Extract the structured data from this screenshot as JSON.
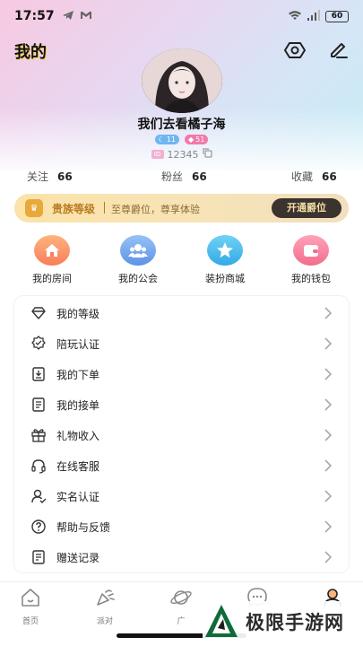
{
  "status_bar": {
    "time": "17:57",
    "battery": "60"
  },
  "header": {
    "title": "我的"
  },
  "profile": {
    "username": "我们去看橘子海",
    "badge_level_1": "11",
    "badge_level_2": "51",
    "user_id": "12345"
  },
  "stats": {
    "following_label": "关注",
    "following_value": "66",
    "fans_label": "粉丝",
    "fans_value": "66",
    "favorites_label": "收藏",
    "favorites_value": "66"
  },
  "noble": {
    "title": "贵族等级",
    "description": "至尊爵位，尊享体验",
    "button": "开通爵位"
  },
  "quick_actions": [
    {
      "label": "我的房间",
      "icon": "house-icon"
    },
    {
      "label": "我的公会",
      "icon": "group-icon"
    },
    {
      "label": "装扮商城",
      "icon": "star-icon"
    },
    {
      "label": "我的钱包",
      "icon": "wallet-icon"
    }
  ],
  "menu": [
    {
      "label": "我的等级",
      "icon": "diamond-icon"
    },
    {
      "label": "陪玩认证",
      "icon": "certificate-icon"
    },
    {
      "label": "我的下单",
      "icon": "order-icon"
    },
    {
      "label": "我的接单",
      "icon": "receive-order-icon"
    },
    {
      "label": "礼物收入",
      "icon": "gift-icon"
    },
    {
      "label": "在线客服",
      "icon": "headset-icon"
    },
    {
      "label": "实名认证",
      "icon": "user-verify-icon"
    },
    {
      "label": "帮助与反馈",
      "icon": "help-icon"
    },
    {
      "label": "赠送记录",
      "icon": "record-icon"
    }
  ],
  "tabbar": [
    {
      "label": "首页",
      "icon": "home-icon"
    },
    {
      "label": "派对",
      "icon": "party-icon"
    },
    {
      "label": "广",
      "icon": "planet-icon"
    },
    {
      "label": "",
      "icon": "chat-icon"
    },
    {
      "label": "",
      "icon": "profile-icon"
    }
  ],
  "watermark": {
    "text": "极限手游网"
  },
  "colors": {
    "accent_gold": "#b97a1f",
    "noble_button_bg": "#3a332e",
    "noble_button_text": "#f6dfa8",
    "badge_blue": "#6fb6f0",
    "badge_pink": "#f07aaa"
  }
}
